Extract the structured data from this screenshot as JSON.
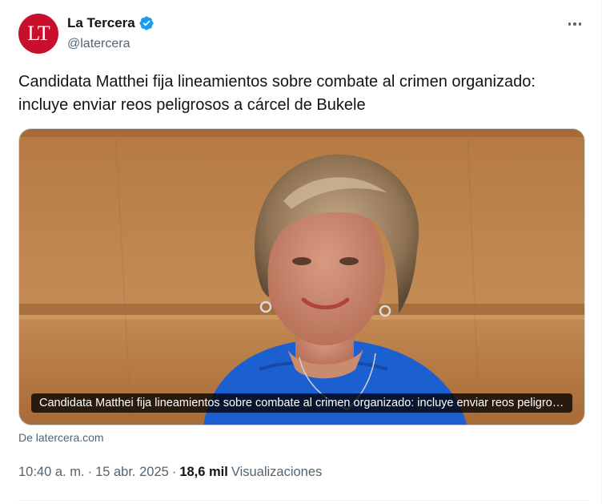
{
  "author": {
    "avatar_text": "LT",
    "display_name": "La Tercera",
    "handle": "@latercera",
    "verified": true
  },
  "tweet": {
    "text": "Candidata Matthei fija lineamientos sobre combate al crimen organizado: incluye enviar reos peligrosos a cárcel de Bukele",
    "media_caption": "Candidata Matthei fija lineamientos sobre combate al crimen organizado: incluye enviar reos peligrosos a cárcel de Bukele",
    "source": "De latercera.com"
  },
  "meta": {
    "time": "10:40 a. m.",
    "separator": "·",
    "date": "15 abr. 2025",
    "views_count": "18,6 mil",
    "views_label": "Visualizaciones"
  },
  "colors": {
    "brand_red": "#c8102e",
    "verified_blue": "#1d9bf0",
    "secondary_text": "#536471"
  },
  "icons": {
    "more": "more-dots-icon",
    "verified": "verified-badge-icon"
  }
}
